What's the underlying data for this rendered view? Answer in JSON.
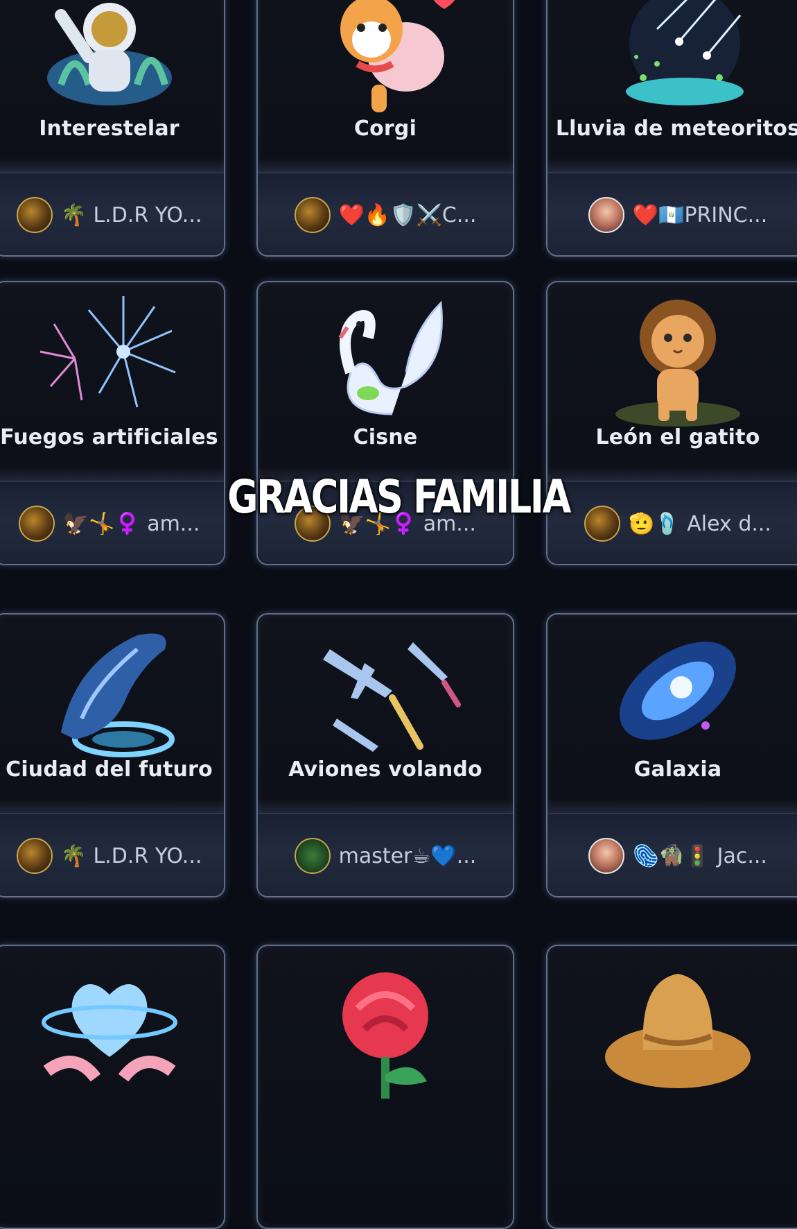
{
  "overlay_caption": "GRACIAS FAMILIA",
  "gifts": [
    {
      "name": "Interestelar",
      "sender": "🌴 L.D.R YO...",
      "icon": "astronaut-icon",
      "avatar": "gold-emblem"
    },
    {
      "name": "Corgi",
      "sender": "❤️🔥🛡️⚔️C...",
      "icon": "corgi-icon",
      "avatar": "gold-emblem"
    },
    {
      "name": "Lluvia de meteoritos",
      "sender": "❤️🇬🇹PRINC...",
      "icon": "meteor-shower-icon",
      "avatar": "photo"
    },
    {
      "name": "Fuegos artificiales",
      "sender": "🦅🤸♀️ am...",
      "icon": "fireworks-icon",
      "avatar": "gold-emblem"
    },
    {
      "name": "Cisne",
      "sender": "🦅🤸♀️ am...",
      "icon": "swan-icon",
      "avatar": "gold-emblem"
    },
    {
      "name": "León el gatito",
      "sender": "🫡🩴 Alex d...",
      "icon": "lion-icon",
      "avatar": "gold-emblem"
    },
    {
      "name": "Ciudad del futuro",
      "sender": "🌴 L.D.R YO...",
      "icon": "whale-icon",
      "avatar": "gold-emblem"
    },
    {
      "name": "Aviones volando",
      "sender": "master☕💙...",
      "icon": "airplanes-icon",
      "avatar": "green"
    },
    {
      "name": "Galaxia",
      "sender": "🫆🧌🚦 Jac...",
      "icon": "galaxy-icon",
      "avatar": "photo"
    },
    {
      "name": "",
      "sender": "",
      "icon": "heart-hands-icon",
      "avatar": ""
    },
    {
      "name": "",
      "sender": "",
      "icon": "rose-icon",
      "avatar": ""
    },
    {
      "name": "",
      "sender": "",
      "icon": "cowboy-hat-icon",
      "avatar": ""
    }
  ]
}
